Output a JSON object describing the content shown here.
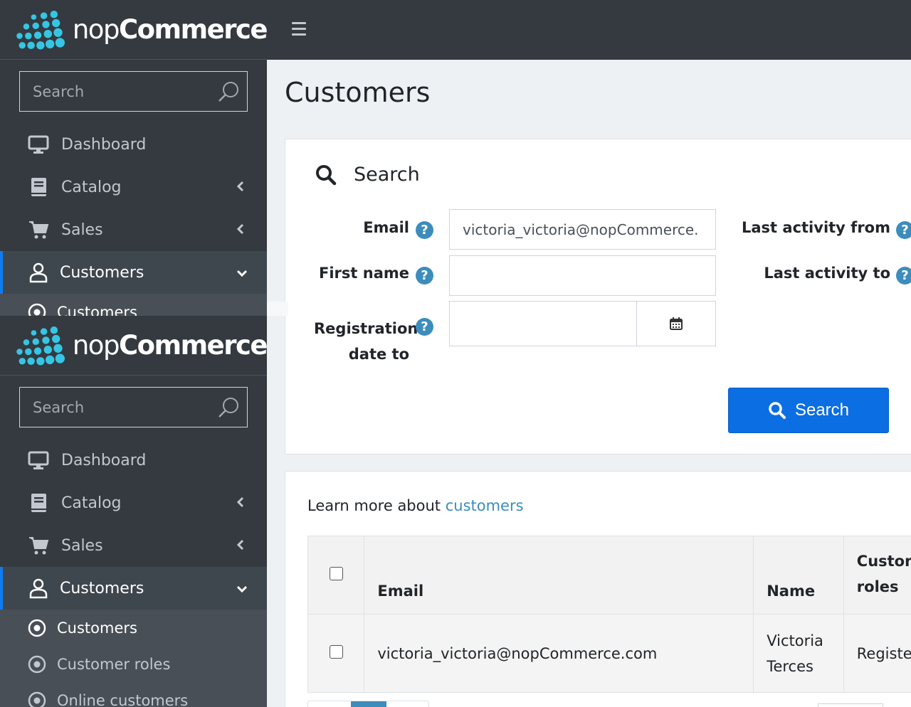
{
  "brand": {
    "name_light": "nop",
    "name_bold": "Commerce"
  },
  "sidebar": {
    "search_placeholder": "Search",
    "items": [
      {
        "label": "Dashboard",
        "icon": "desktop-icon"
      },
      {
        "label": "Catalog",
        "icon": "book-icon"
      },
      {
        "label": "Sales",
        "icon": "cart-icon"
      },
      {
        "label": "Customers",
        "icon": "user-icon"
      }
    ],
    "sub_items": [
      {
        "label": "Customers",
        "icon": "circle-dot-icon"
      },
      {
        "label": "Customer roles",
        "icon": "circle-dot-icon"
      },
      {
        "label": "Online customers",
        "icon": "circle-dot-icon"
      }
    ]
  },
  "page": {
    "title": "Customers"
  },
  "search_panel": {
    "title": "Search",
    "email_label": "Email",
    "email_value": "victoria_victoria@nopCommerce.",
    "first_name_label": "First name",
    "first_name_value": "",
    "registration_to_label_1": "Registration",
    "registration_to_label_2": "date to",
    "last_activity_from_label": "Last activity from",
    "last_activity_to_label": "Last activity to",
    "help_glyph": "?",
    "button_label": "Search"
  },
  "list_panel": {
    "learn_prefix": "Learn more about ",
    "learn_link": "customers",
    "columns": {
      "email": "Email",
      "name": "Name",
      "roles_1": "Custom",
      "roles_2": "roles"
    },
    "rows": [
      {
        "email": "victoria_victoria@nopCommerce.com",
        "name_1": "Victoria",
        "name_2": "Terces",
        "roles": "Registe"
      }
    ]
  },
  "colors": {
    "sidebar_bg": "#343a40",
    "accent": "#0b6ee3",
    "help": "#3c8dbc",
    "active_border": "#0d7cf0"
  }
}
